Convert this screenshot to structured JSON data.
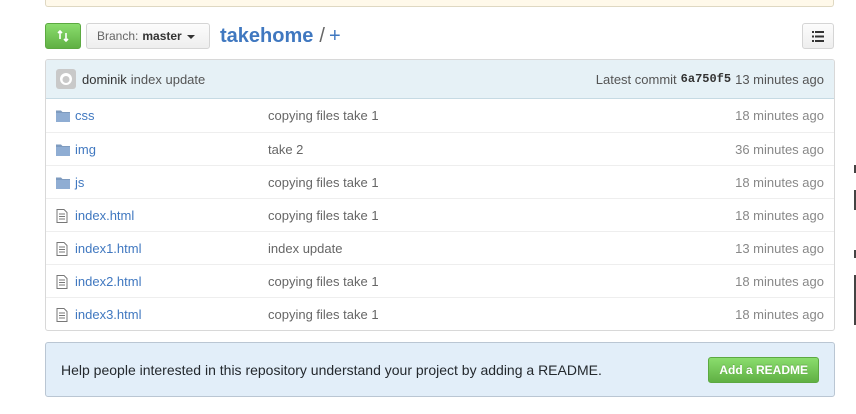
{
  "file_nav": {
    "branch_prefix": "Branch:",
    "branch_name": "master",
    "repo_name": "takehome",
    "path_separator": "/",
    "add_file_label": "+"
  },
  "commit": {
    "author": "dominik",
    "message": "index update",
    "latest_label": "Latest commit",
    "sha": "6a750f5",
    "age": "13 minutes ago"
  },
  "files": [
    {
      "type": "folder",
      "name": "css",
      "message": "copying files take 1",
      "age": "18 minutes ago"
    },
    {
      "type": "folder",
      "name": "img",
      "message": "take 2",
      "age": "36 minutes ago"
    },
    {
      "type": "folder",
      "name": "js",
      "message": "copying files take 1",
      "age": "18 minutes ago"
    },
    {
      "type": "file",
      "name": "index.html",
      "message": "copying files take 1",
      "age": "18 minutes ago"
    },
    {
      "type": "file",
      "name": "index1.html",
      "message": "index update",
      "age": "13 minutes ago"
    },
    {
      "type": "file",
      "name": "index2.html",
      "message": "copying files take 1",
      "age": "18 minutes ago"
    },
    {
      "type": "file",
      "name": "index3.html",
      "message": "copying files take 1",
      "age": "18 minutes ago"
    }
  ],
  "readme_prompt": {
    "text": "Help people interested in this repository understand your project by adding a README.",
    "button_label": "Add a README"
  },
  "icons": {
    "compare": "compare-icon",
    "branch_caret": "caret-down-icon",
    "list": "list-icon",
    "folder": "folder-icon",
    "file": "file-text-icon",
    "avatar": "avatar-icon"
  },
  "colors": {
    "link": "#4078c0",
    "green": "#6cc644",
    "commit_bg": "#e6f1f6",
    "readme_bg": "#e2eef9"
  }
}
